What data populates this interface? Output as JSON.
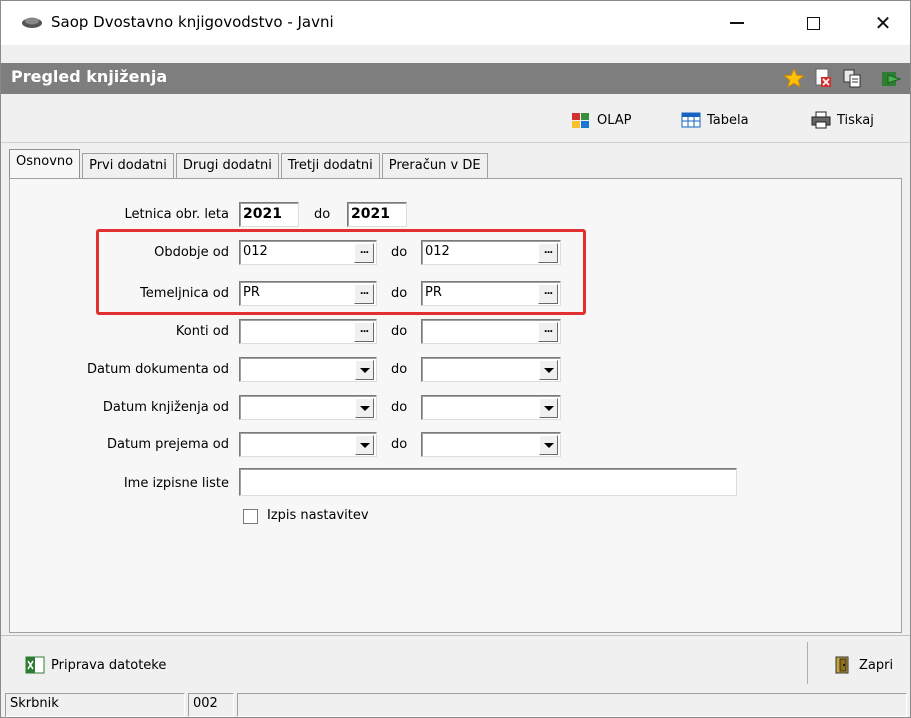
{
  "window": {
    "title": "Saop Dvostavno knjigovodstvo - Javni",
    "controls": {
      "minimize": "—",
      "close": "✕"
    }
  },
  "header": {
    "title": "Pregled knjiženja",
    "icons": [
      "star-icon",
      "delete-document-icon",
      "copy-icon",
      "exit-icon"
    ]
  },
  "toolbar": {
    "olap_label": "OLAP",
    "tabela_label": "Tabela",
    "tiskaj_label": "Tiskaj"
  },
  "tabs": [
    {
      "label": "Osnovno",
      "active": true
    },
    {
      "label": "Prvi dodatni",
      "active": false
    },
    {
      "label": "Drugi dodatni",
      "active": false
    },
    {
      "label": "Tretji dodatni",
      "active": false
    },
    {
      "label": "Preračun v DE",
      "active": false
    }
  ],
  "form": {
    "letnica": {
      "label": "Letnica obr. leta",
      "from": "2021",
      "to_label": "do",
      "to": "2021"
    },
    "obdobje": {
      "label": "Obdobje od",
      "from": "012",
      "to_label": "do",
      "to": "012"
    },
    "temeljnica": {
      "label": "Temeljnica od",
      "from": "PR",
      "to_label": "do",
      "to": "PR"
    },
    "konti": {
      "label": "Konti od",
      "from": "",
      "to_label": "do",
      "to": ""
    },
    "datum_dokumenta": {
      "label": "Datum dokumenta od",
      "from": "",
      "to_label": "do",
      "to": ""
    },
    "datum_knjizenja": {
      "label": "Datum knjiženja od",
      "from": "",
      "to_label": "do",
      "to": ""
    },
    "datum_prejema": {
      "label": "Datum prejema od",
      "from": "",
      "to_label": "do",
      "to": ""
    },
    "ime_izpisne_liste": {
      "label": "Ime izpisne liste",
      "value": ""
    },
    "izpis_nastavitev": {
      "label": "Izpis nastavitev",
      "checked": false
    },
    "ellipsis": "..."
  },
  "bottom": {
    "priprava_label": "Priprava datoteke",
    "zapri_label": "Zapri"
  },
  "status": {
    "user": "Skrbnik",
    "code": "002"
  },
  "colors": {
    "header_bg": "#7e7e7e",
    "highlight": "#e03030"
  }
}
